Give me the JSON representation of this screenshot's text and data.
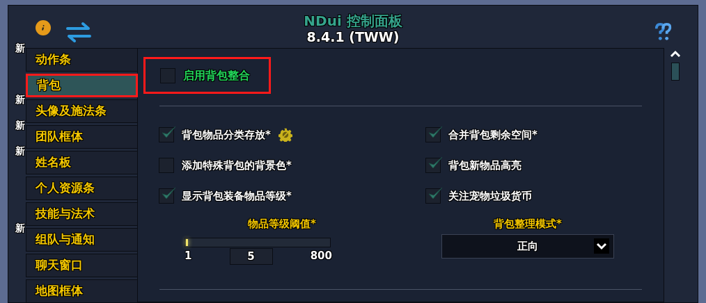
{
  "window": {
    "title": "NDui 控制面板",
    "version": "8.4.1 (TWW)"
  },
  "sidebar": {
    "items": [
      {
        "label": "动作条",
        "badge": "新",
        "selected": false,
        "highlighted": false
      },
      {
        "label": "背包",
        "selected": true,
        "highlighted": true
      },
      {
        "label": "头像及施法条",
        "badge": "新",
        "selected": false,
        "highlighted": false
      },
      {
        "label": "团队框体",
        "badge": "新",
        "selected": false,
        "highlighted": false
      },
      {
        "label": "姓名板",
        "badge": "新",
        "selected": false,
        "highlighted": false
      },
      {
        "label": "个人资源条",
        "selected": false,
        "highlighted": false
      },
      {
        "label": "技能与法术",
        "selected": false,
        "highlighted": false
      },
      {
        "label": "组队与通知",
        "badge": "新",
        "selected": false,
        "highlighted": false
      },
      {
        "label": "聊天窗口",
        "selected": false,
        "highlighted": false
      },
      {
        "label": "地图框体",
        "selected": false,
        "highlighted": false
      }
    ]
  },
  "master_toggle": {
    "label": "启用背包整合",
    "checked": false,
    "highlighted": true
  },
  "options": [
    {
      "label": "背包物品分类存放*",
      "checked": true,
      "has_settings": true
    },
    {
      "label": "合并背包剩余空间*",
      "checked": true,
      "has_settings": false
    },
    {
      "label": "添加特殊背包的背景色*",
      "checked": false,
      "has_settings": false
    },
    {
      "label": "背包新物品高亮",
      "checked": true,
      "has_settings": false
    },
    {
      "label": "显示背包装备物品等级*",
      "checked": true,
      "has_settings": false
    },
    {
      "label": "关注宠物垃圾货币",
      "checked": true,
      "has_settings": false
    }
  ],
  "slider": {
    "label": "物品等级阈值*",
    "level": 0.005,
    "min": "1",
    "value": "5",
    "max": "800"
  },
  "dropdown": {
    "label": "背包整理模式*",
    "value": "正向"
  }
}
